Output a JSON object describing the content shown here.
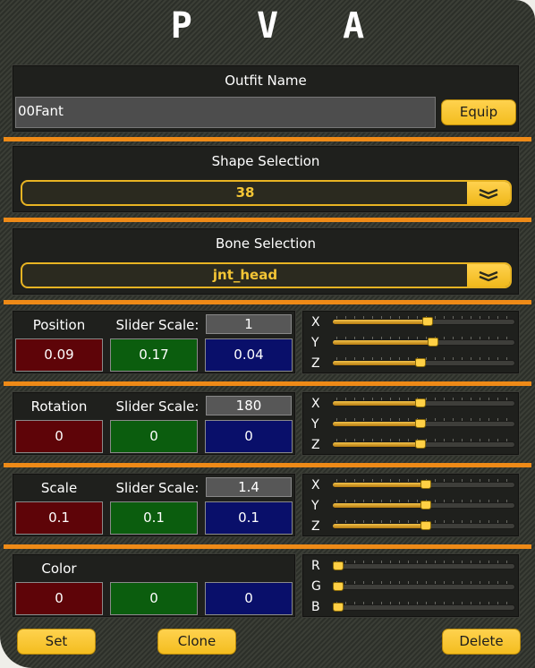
{
  "app": {
    "title": "P V A"
  },
  "outfit": {
    "label": "Outfit Name",
    "value": "00Fant",
    "equip_label": "Equip"
  },
  "shape": {
    "label": "Shape Selection",
    "selected": "38"
  },
  "bone": {
    "label": "Bone Selection",
    "selected": "jnt_head"
  },
  "position": {
    "label": "Position",
    "slider_scale_label": "Slider Scale:",
    "slider_scale": "1",
    "x": "0.09",
    "y": "0.17",
    "z": "0.04",
    "axes": [
      {
        "name": "X",
        "level": 0.52
      },
      {
        "name": "Y",
        "level": 0.55
      },
      {
        "name": "Z",
        "level": 0.48
      }
    ]
  },
  "rotation": {
    "label": "Rotation",
    "slider_scale_label": "Slider Scale:",
    "slider_scale": "180",
    "x": "0",
    "y": "0",
    "z": "0",
    "axes": [
      {
        "name": "X",
        "level": 0.48
      },
      {
        "name": "Y",
        "level": 0.48
      },
      {
        "name": "Z",
        "level": 0.48
      }
    ]
  },
  "scale": {
    "label": "Scale",
    "slider_scale_label": "Slider Scale:",
    "slider_scale": "1.4",
    "x": "0.1",
    "y": "0.1",
    "z": "0.1",
    "axes": [
      {
        "name": "X",
        "level": 0.51
      },
      {
        "name": "Y",
        "level": 0.51
      },
      {
        "name": "Z",
        "level": 0.51
      }
    ]
  },
  "color": {
    "label": "Color",
    "r": "0",
    "g": "0",
    "b": "0",
    "channels": [
      {
        "name": "R",
        "level": 0.0
      },
      {
        "name": "G",
        "level": 0.0
      },
      {
        "name": "B",
        "level": 0.0
      }
    ]
  },
  "footer": {
    "set_label": "Set",
    "clone_label": "Clone",
    "delete_label": "Delete"
  },
  "colors": {
    "accent_orange": "#ee8a17",
    "button_yellow": "#ffd24e",
    "value_red": "#5e0408",
    "value_green": "#0b5d0e",
    "value_blue": "#090f6a"
  }
}
